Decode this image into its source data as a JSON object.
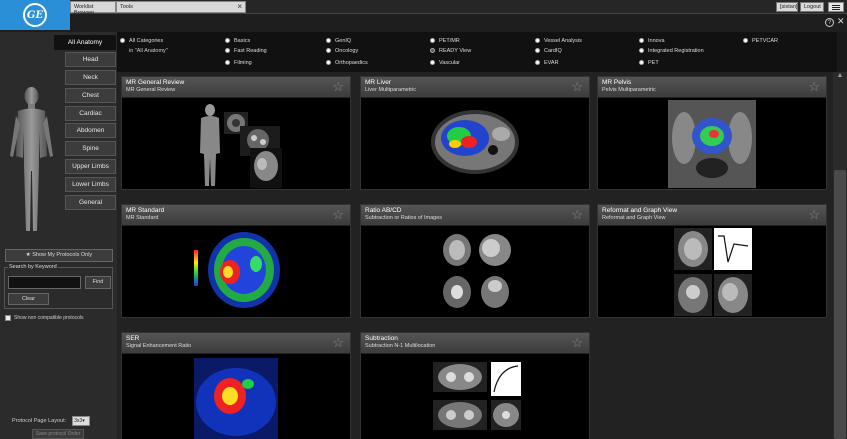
{
  "app": {
    "logo_text": "GE",
    "tabs": [
      "Worklist Browser",
      "Tools"
    ],
    "user_label": "[sistan]",
    "logout_label": "Logout",
    "help_symbol": "?",
    "close_symbol": "✕"
  },
  "anatomy": {
    "tabs": [
      "All Anatomy",
      "Head",
      "Neck",
      "Chest",
      "Cardiac",
      "Abdomen",
      "Spine",
      "Upper Limbs",
      "Lower Limbs",
      "General"
    ],
    "active": "All Anatomy"
  },
  "left": {
    "show_my_protocols_label": "Show My Protocols Only",
    "search_legend": "Search by Keyword",
    "search_value": "",
    "find_label": "Find",
    "clear_label": "Clear",
    "non_compatible_label": "Show non compatible protocols",
    "layout_label": "Protocol Page Layout:",
    "layout_value": "3x3",
    "save_order_label": "Save protocol Order"
  },
  "categories": {
    "items": [
      {
        "label": "All Categories",
        "selected": false
      },
      {
        "label": "in \"All Anatomy\"",
        "sub": true
      },
      {
        "label": "Basics",
        "selected": false
      },
      {
        "label": "Fast Reading",
        "selected": false
      },
      {
        "label": "Filming",
        "selected": false
      },
      {
        "label": "GenIQ",
        "selected": false
      },
      {
        "label": "Oncology",
        "selected": false
      },
      {
        "label": "Orthopaedics",
        "selected": false
      },
      {
        "label": "PET/MR",
        "selected": false
      },
      {
        "label": "READY View",
        "selected": true
      },
      {
        "label": "Vascular",
        "selected": false
      },
      {
        "label": "Vessel Analysis",
        "selected": false
      },
      {
        "label": "CardIQ",
        "selected": false
      },
      {
        "label": "EVAR",
        "selected": false
      },
      {
        "label": "Innova",
        "selected": false
      },
      {
        "label": "Integrated Registration",
        "selected": false
      },
      {
        "label": "PET",
        "selected": false
      },
      {
        "label": "PETVCAR",
        "selected": false
      }
    ]
  },
  "cards": [
    {
      "title": "MR General Review",
      "subtitle": "MR General Review"
    },
    {
      "title": "MR Liver",
      "subtitle": "Liver Multiparametric"
    },
    {
      "title": "MR Pelvis",
      "subtitle": "Pelvis Multiparametric"
    },
    {
      "title": "MR Standard",
      "subtitle": "MR Standard"
    },
    {
      "title": "Ratio AB/CD",
      "subtitle": "Subtraction or Ratios of Images"
    },
    {
      "title": "Reformat and Graph View",
      "subtitle": "Reformat and Graph View"
    },
    {
      "title": "SER",
      "subtitle": "Signal Enhancement Ratio"
    },
    {
      "title": "Subtraction",
      "subtitle": "Subtraction N-1 Multilocation"
    }
  ],
  "icons": {
    "star": "star-icon",
    "help": "help-icon",
    "close": "close-icon",
    "menu": "hamburger-menu-icon",
    "body": "body-figure-icon"
  },
  "colors": {
    "ge_blue": "#2a8fd6",
    "background": "#1a1a1a",
    "card_header": "#4a4a4a"
  }
}
